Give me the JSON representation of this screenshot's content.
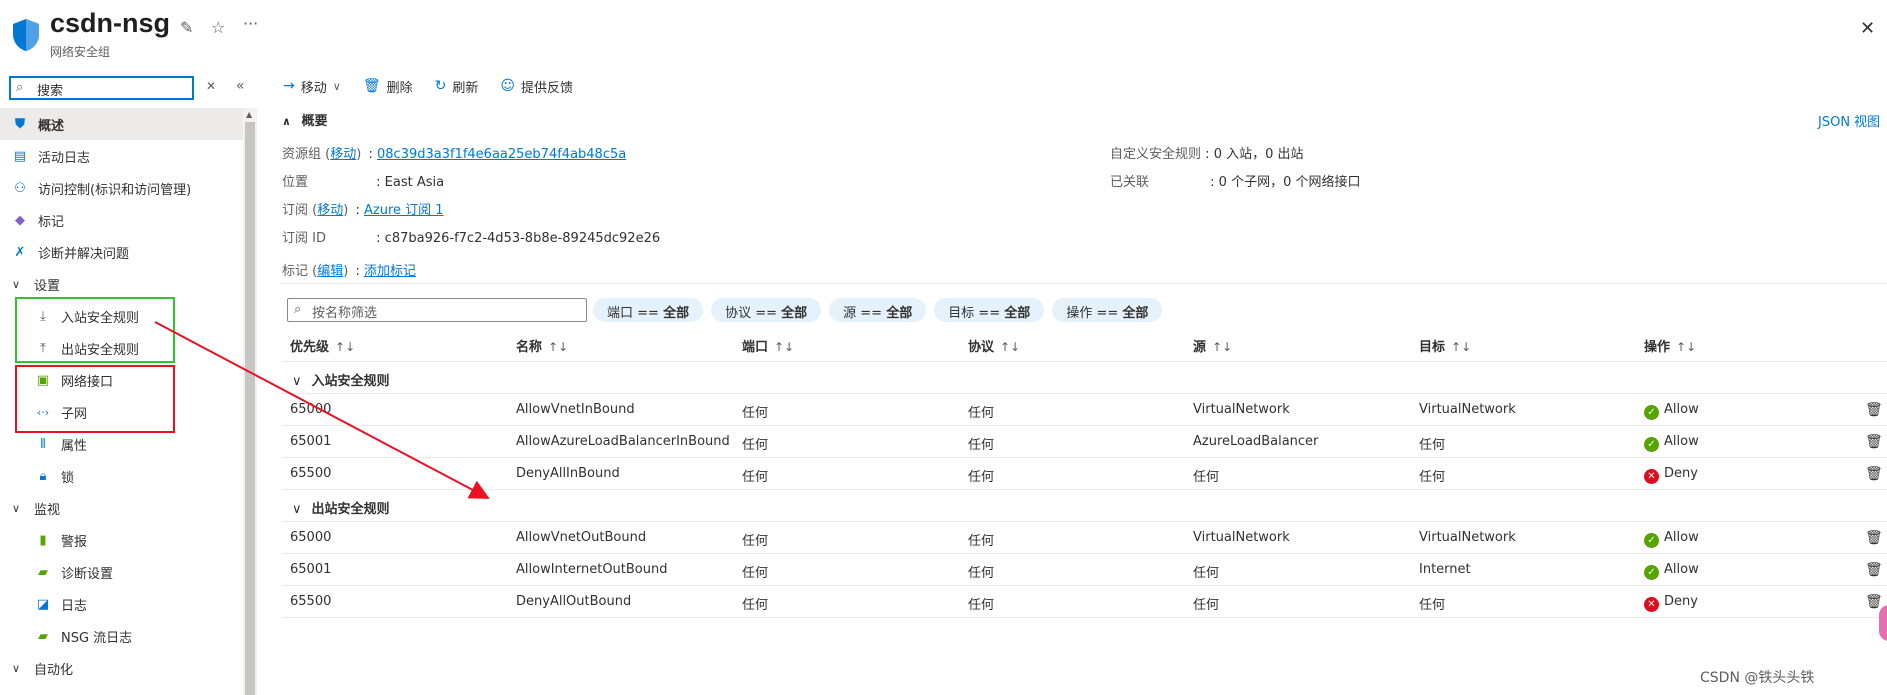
{
  "header": {
    "title": "csdn-nsg",
    "subtitle": "网络安全组",
    "more": "···"
  },
  "sidebar": {
    "search_value": "搜索",
    "items": [
      {
        "label": "概述"
      },
      {
        "label": "活动日志"
      },
      {
        "label": "访问控制(标识和访问管理)"
      },
      {
        "label": "标记"
      },
      {
        "label": "诊断并解决问题"
      },
      {
        "label": "设置"
      },
      {
        "label": "入站安全规则"
      },
      {
        "label": "出站安全规则"
      },
      {
        "label": "网络接口"
      },
      {
        "label": "子网"
      },
      {
        "label": "属性"
      },
      {
        "label": "锁"
      },
      {
        "label": "监视"
      },
      {
        "label": "警报"
      },
      {
        "label": "诊断设置"
      },
      {
        "label": "日志"
      },
      {
        "label": "NSG 流日志"
      },
      {
        "label": "自动化"
      }
    ]
  },
  "toolbar": {
    "move": "移动",
    "delete": "删除",
    "refresh": "刷新",
    "feedback": "提供反馈"
  },
  "essentials": {
    "title": "概要",
    "json_view": "JSON 视图",
    "rg_key": "资源组",
    "rg_move": "移动",
    "rg_value": "08c39d3a3f1f4e6aa25eb74f4ab48c5a",
    "loc_key": "位置",
    "loc_value": "East Asia",
    "sub_key": "订阅",
    "sub_move": "移动",
    "sub_value": "Azure 订阅 1",
    "subid_key": "订阅 ID",
    "subid_value": "c87ba926-f7c2-4d53-8b8e-89245dc92e26",
    "tag_key": "标记",
    "tag_edit": "编辑",
    "tag_value": "添加标记",
    "custom_key": "自定义安全规则",
    "custom_value": "0 入站，0 出站",
    "assoc_key": "已关联",
    "assoc_value": "0 个子网，0 个网络接口"
  },
  "filters": {
    "placeholder": "按名称筛选",
    "pills": [
      {
        "k": "端口 == ",
        "v": "全部"
      },
      {
        "k": "协议 == ",
        "v": "全部"
      },
      {
        "k": "源 == ",
        "v": "全部"
      },
      {
        "k": "目标 == ",
        "v": "全部"
      },
      {
        "k": "操作 == ",
        "v": "全部"
      }
    ]
  },
  "grid": {
    "columns": [
      "优先级",
      "名称",
      "端口",
      "协议",
      "源",
      "目标",
      "操作"
    ],
    "groups": [
      {
        "label": "入站安全规则",
        "rows": [
          {
            "priority": "65000",
            "name": "AllowVnetInBound",
            "port": "任何",
            "protocol": "任何",
            "source": "VirtualNetwork",
            "dest": "VirtualNetwork",
            "action": "Allow"
          },
          {
            "priority": "65001",
            "name": "AllowAzureLoadBalancerInBound",
            "port": "任何",
            "protocol": "任何",
            "source": "AzureLoadBalancer",
            "dest": "任何",
            "action": "Allow"
          },
          {
            "priority": "65500",
            "name": "DenyAllInBound",
            "port": "任何",
            "protocol": "任何",
            "source": "任何",
            "dest": "任何",
            "action": "Deny"
          }
        ]
      },
      {
        "label": "出站安全规则",
        "rows": [
          {
            "priority": "65000",
            "name": "AllowVnetOutBound",
            "port": "任何",
            "protocol": "任何",
            "source": "VirtualNetwork",
            "dest": "VirtualNetwork",
            "action": "Allow"
          },
          {
            "priority": "65001",
            "name": "AllowInternetOutBound",
            "port": "任何",
            "protocol": "任何",
            "source": "任何",
            "dest": "Internet",
            "action": "Allow"
          },
          {
            "priority": "65500",
            "name": "DenyAllOutBound",
            "port": "任何",
            "protocol": "任何",
            "source": "任何",
            "dest": "任何",
            "action": "Deny"
          }
        ]
      }
    ]
  },
  "watermark": "CSDN @铁头头铁",
  "colors": {
    "accent": "#0078d4",
    "allow": "#57a300",
    "deny": "#e00b1c",
    "highlight_green": "#2fc52f",
    "highlight_red": "#e81123"
  }
}
